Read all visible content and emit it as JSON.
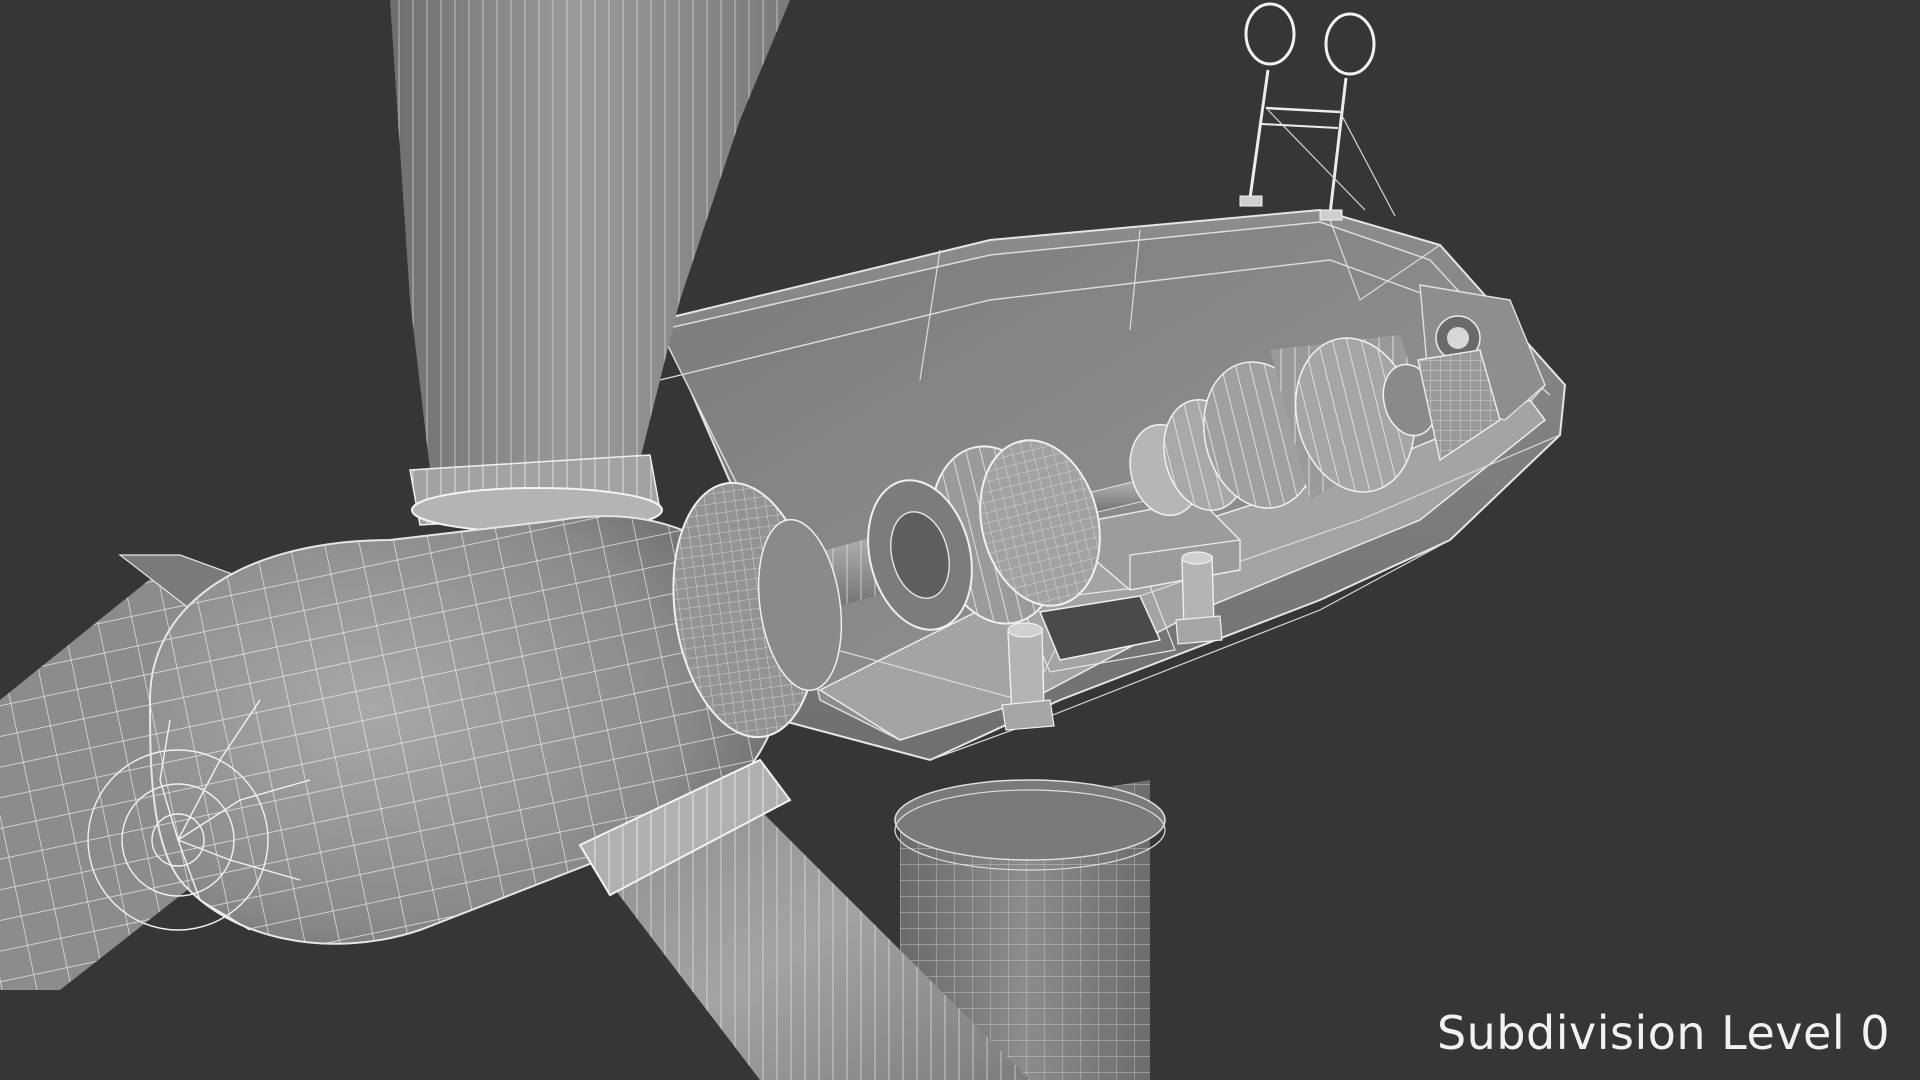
{
  "caption": "Subdivision Level 0"
}
